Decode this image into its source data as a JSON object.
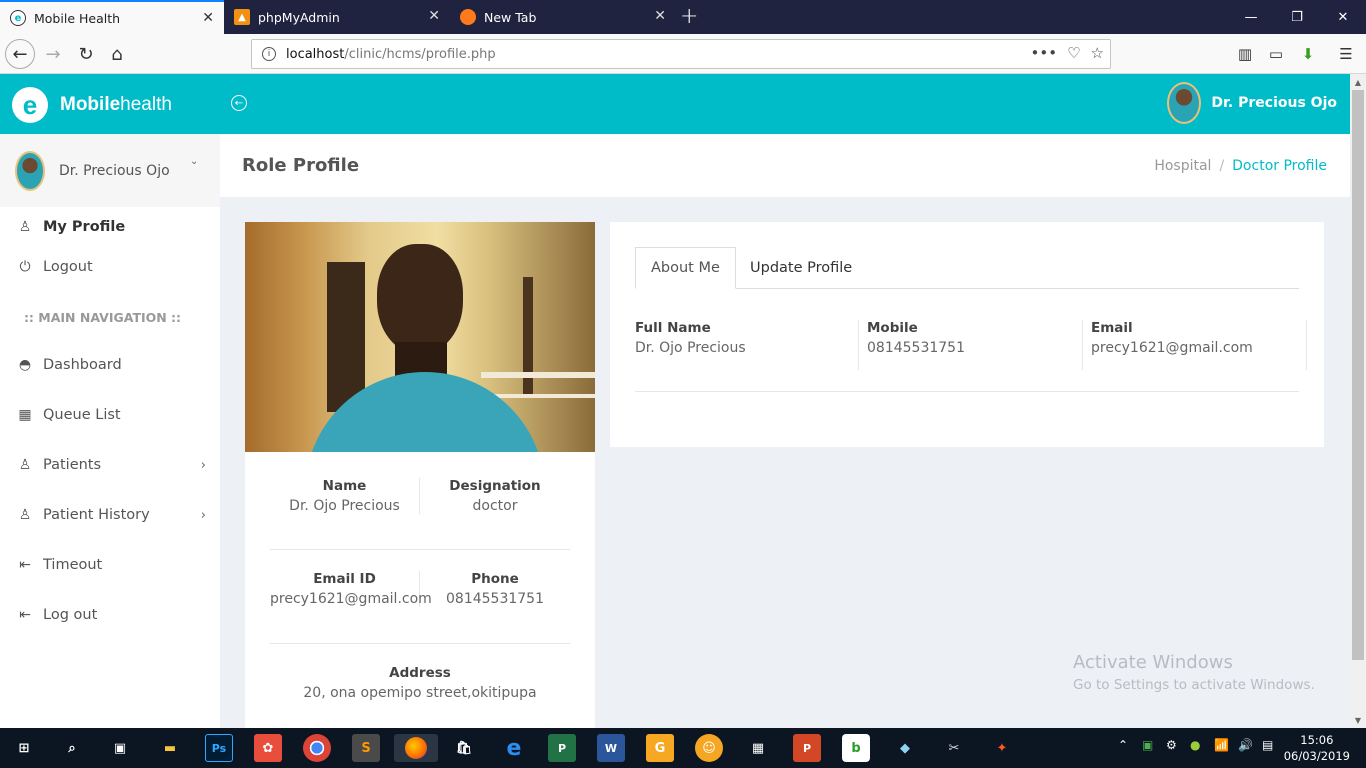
{
  "browser": {
    "tabs": [
      {
        "title": "Mobile Health",
        "active": true
      },
      {
        "title": "phpMyAdmin",
        "active": false
      },
      {
        "title": "New Tab",
        "active": false
      }
    ],
    "url_host": "localhost",
    "url_path": "/clinic/hcms/profile.php"
  },
  "header": {
    "brand_bold": "Mobile",
    "brand_light": "health",
    "user_name": "Dr. Precious Ojo",
    "accent_color": "#00bcc8"
  },
  "sidebar": {
    "user_name": "Dr. Precious Ojo",
    "top_items": [
      {
        "label": "My Profile",
        "icon": "user-icon"
      },
      {
        "label": "Logout",
        "icon": "power-icon"
      }
    ],
    "nav_heading": ":: MAIN NAVIGATION ::",
    "items": [
      {
        "label": "Dashboard",
        "icon": "dashboard-icon"
      },
      {
        "label": "Queue List",
        "icon": "calendar-icon"
      },
      {
        "label": "Patients",
        "icon": "users-icon"
      },
      {
        "label": "Patient History",
        "icon": "users-icon"
      },
      {
        "label": "Timeout",
        "icon": "signout-icon"
      },
      {
        "label": "Log out",
        "icon": "signout-icon"
      }
    ]
  },
  "page": {
    "title": "Role Profile",
    "breadcrumb": [
      "Hospital",
      "Doctor Profile"
    ]
  },
  "profile_card": {
    "name_label": "Name",
    "name": "Dr. Ojo Precious",
    "designation_label": "Designation",
    "designation": "doctor",
    "email_label": "Email ID",
    "email": "precy1621@gmail.com",
    "phone_label": "Phone",
    "phone": "08145531751",
    "address_label": "Address",
    "address": "20, ona opemipo street,okitipupa"
  },
  "about": {
    "tabs": [
      "About Me",
      "Update Profile"
    ],
    "fields": [
      {
        "label": "Full Name",
        "value": "Dr. Ojo Precious"
      },
      {
        "label": "Mobile",
        "value": "08145531751"
      },
      {
        "label": "Email",
        "value": "precy1621@gmail.com"
      }
    ]
  },
  "watermark": {
    "line1": "Activate Windows",
    "line2": "Go to Settings to activate Windows."
  },
  "taskbar": {
    "time": "15:06",
    "date": "06/03/2019"
  }
}
